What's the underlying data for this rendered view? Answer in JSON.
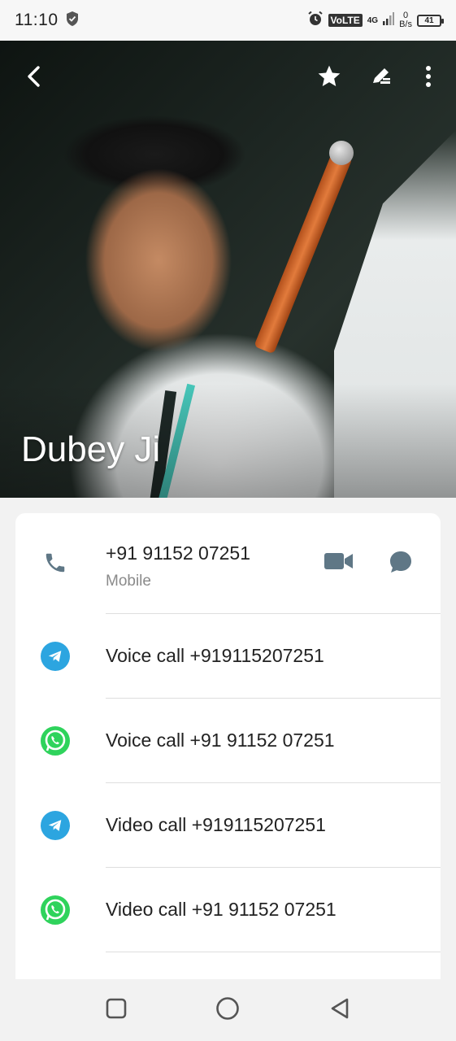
{
  "status_bar": {
    "time": "11:10",
    "network_label": "VoLTE",
    "network_type": "4G",
    "speed_value": "0",
    "speed_unit": "B/s",
    "battery_level": "41"
  },
  "header": {
    "contact_name": "Dubey Ji"
  },
  "primary_phone": {
    "number": "+91 91152 07251",
    "type": "Mobile"
  },
  "actions": [
    {
      "app": "telegram",
      "label": "Voice call +919115207251"
    },
    {
      "app": "whatsapp",
      "label": "Voice call +91 91152 07251"
    },
    {
      "app": "telegram",
      "label": "Video call +919115207251"
    },
    {
      "app": "whatsapp",
      "label": "Video call +91 91152 07251"
    }
  ],
  "icons": {
    "back": "chevron-left-icon",
    "favorite": "star-icon",
    "edit": "edit-icon",
    "more": "more-vert-icon",
    "call": "phone-icon",
    "video": "video-camera-icon",
    "message": "message-icon",
    "telegram": "telegram-icon",
    "whatsapp": "whatsapp-icon",
    "nav_recents": "square-icon",
    "nav_home": "circle-icon",
    "nav_back": "triangle-back-icon"
  },
  "colors": {
    "accent_icon": "#5f7786",
    "telegram": "#2ca5e0",
    "whatsapp": "#2fd35c"
  }
}
